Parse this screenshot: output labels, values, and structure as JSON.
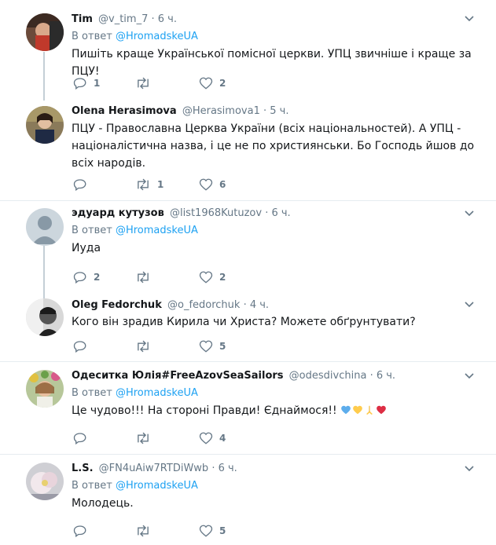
{
  "reply_prefix": "В ответ",
  "tweets": [
    {
      "name": "Tim",
      "handle": "@v_tim_7",
      "time": "· 6 ч.",
      "reply_to": "@HromadskeUA",
      "text": "Пишіть краще Української помісної церкви. УПЦ звичніше і краще за ПЦУ!",
      "replies": "1",
      "retweets": "",
      "likes": "2"
    },
    {
      "name": "Olena Herasimova",
      "handle": "@Herasimova1",
      "time": "· 5 ч.",
      "text": "ПЦУ - Православна Церква України (всіх національностей). А УПЦ - націоналістична назва, і це не по християнськи. Бо Господь йшов до всіх народів.",
      "replies": "",
      "retweets": "1",
      "likes": "6"
    },
    {
      "name": "эдуард кутузов",
      "handle": "@list1968Kutuzov",
      "time": "· 6 ч.",
      "reply_to": "@HromadskeUA",
      "text": "Иуда",
      "replies": "2",
      "retweets": "",
      "likes": "2"
    },
    {
      "name": "Oleg Fedorchuk",
      "handle": "@o_fedorchuk",
      "time": "· 4 ч.",
      "text": "Кого він зрадив Кирила чи Христа? Можете обґрунтувати?",
      "replies": "",
      "retweets": "",
      "likes": "5"
    },
    {
      "name": "Одеситка Юлія#FreeAzovSeaSailors",
      "handle": "@odesdivchina",
      "time": "· 6 ч.",
      "reply_to": "@HromadskeUA",
      "text": "Це чудово!!! На стороні Правди!  Єднаймося!! ",
      "emojis": [
        "blue-heart",
        "yellow-heart",
        "folded-hands",
        "red-heart"
      ],
      "replies": "",
      "retweets": "",
      "likes": "4"
    },
    {
      "name": "L.S.",
      "handle": "@FN4uAiw7RTDiWwb",
      "time": "· 6 ч.",
      "reply_to": "@HromadskeUA",
      "text": "Молодець.",
      "replies": "",
      "retweets": "",
      "likes": "5"
    }
  ]
}
